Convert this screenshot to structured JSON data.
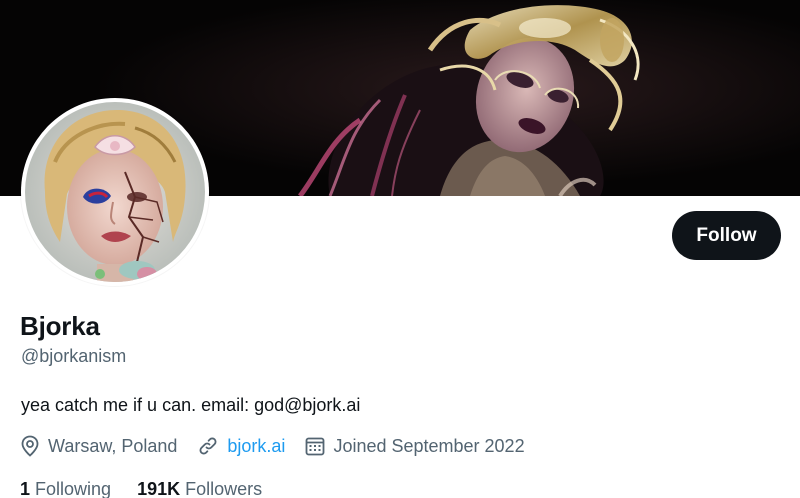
{
  "profile": {
    "display_name": "Bjorka",
    "handle": "@bjorkanism",
    "bio": "yea catch me if u can. email: god@bjork.ai",
    "follow_label": "Follow"
  },
  "meta": {
    "location": "Warsaw, Poland",
    "website": "bjork.ai",
    "joined": "Joined September 2022"
  },
  "stats": {
    "following_count": "1",
    "following_label": "Following",
    "followers_count": "191K",
    "followers_label": "Followers"
  },
  "icons": {
    "location": "map-pin-icon",
    "website": "link-icon",
    "joined": "calendar-icon"
  },
  "colors": {
    "primary_text": "#0f1419",
    "secondary_text": "#536471",
    "link": "#1d9bf0",
    "button_bg": "#0f1419",
    "button_text": "#ffffff",
    "banner_bg": "#050404"
  }
}
